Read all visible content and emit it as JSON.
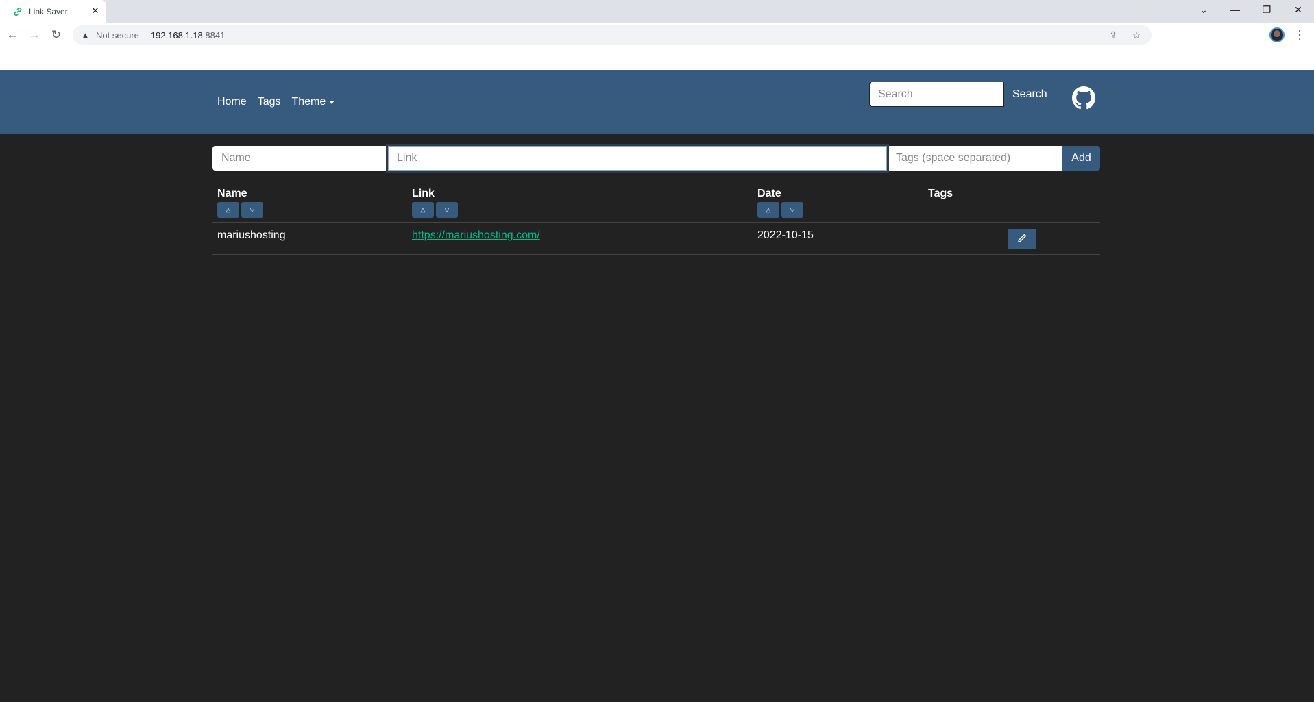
{
  "browser": {
    "tab_title": "Link Saver",
    "favicon": "link-icon",
    "security_label": "Not secure",
    "url_host": "192.168.1.18",
    "url_port": ":8841"
  },
  "navbar": {
    "links": [
      {
        "label": "Home"
      },
      {
        "label": "Tags"
      },
      {
        "label": "Theme"
      }
    ],
    "search_placeholder": "Search",
    "search_button": "Search",
    "github_icon": "github-icon",
    "brand_color": "#375a7f"
  },
  "add_form": {
    "name_placeholder": "Name",
    "link_placeholder": "Link",
    "tags_placeholder": "Tags (space separated)",
    "add_label": "Add"
  },
  "table": {
    "columns": [
      {
        "label": "Name",
        "sortable": true
      },
      {
        "label": "Link",
        "sortable": true
      },
      {
        "label": "Date",
        "sortable": true
      },
      {
        "label": "Tags",
        "sortable": false
      }
    ],
    "rows": [
      {
        "name": "mariushosting",
        "link": "https://mariushosting.com/",
        "date": "2022-10-15",
        "tags": ""
      }
    ],
    "link_color": "#00bc8c"
  }
}
